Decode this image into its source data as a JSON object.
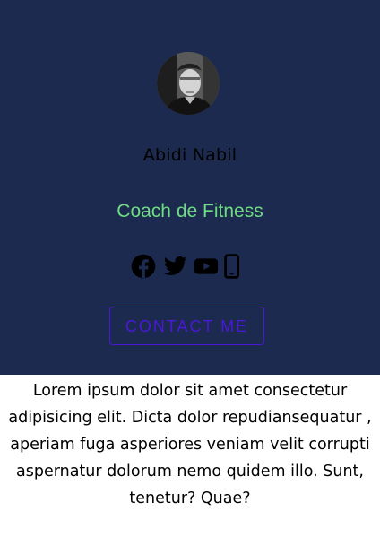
{
  "profile": {
    "name": "Abidi Nabil",
    "role": "Coach de Fitness",
    "avatar_alt": "Abidi Nabil"
  },
  "social": [
    {
      "name": "facebook",
      "icon": "facebook-icon"
    },
    {
      "name": "twitter",
      "icon": "twitter-icon"
    },
    {
      "name": "youtube",
      "icon": "youtube-icon"
    },
    {
      "name": "phone",
      "icon": "mobile-phone-icon"
    }
  ],
  "contact": {
    "label": "CONTACT ME"
  },
  "about": {
    "text": "Lorem ipsum dolor sit amet consectetur adipisicing elit. Dicta dolor repudiansequatur , aperiam fuga asperiores veniam velit corrupti aspernatur dolorum nemo quidem illo. Sunt, tenetur? Quae?"
  },
  "colors": {
    "hero_background": "#1b2a4e",
    "role_text": "#6fdc84",
    "contact_accent": "#4b18d8",
    "icon_color": "#000000",
    "page_background": "#ffffff"
  }
}
